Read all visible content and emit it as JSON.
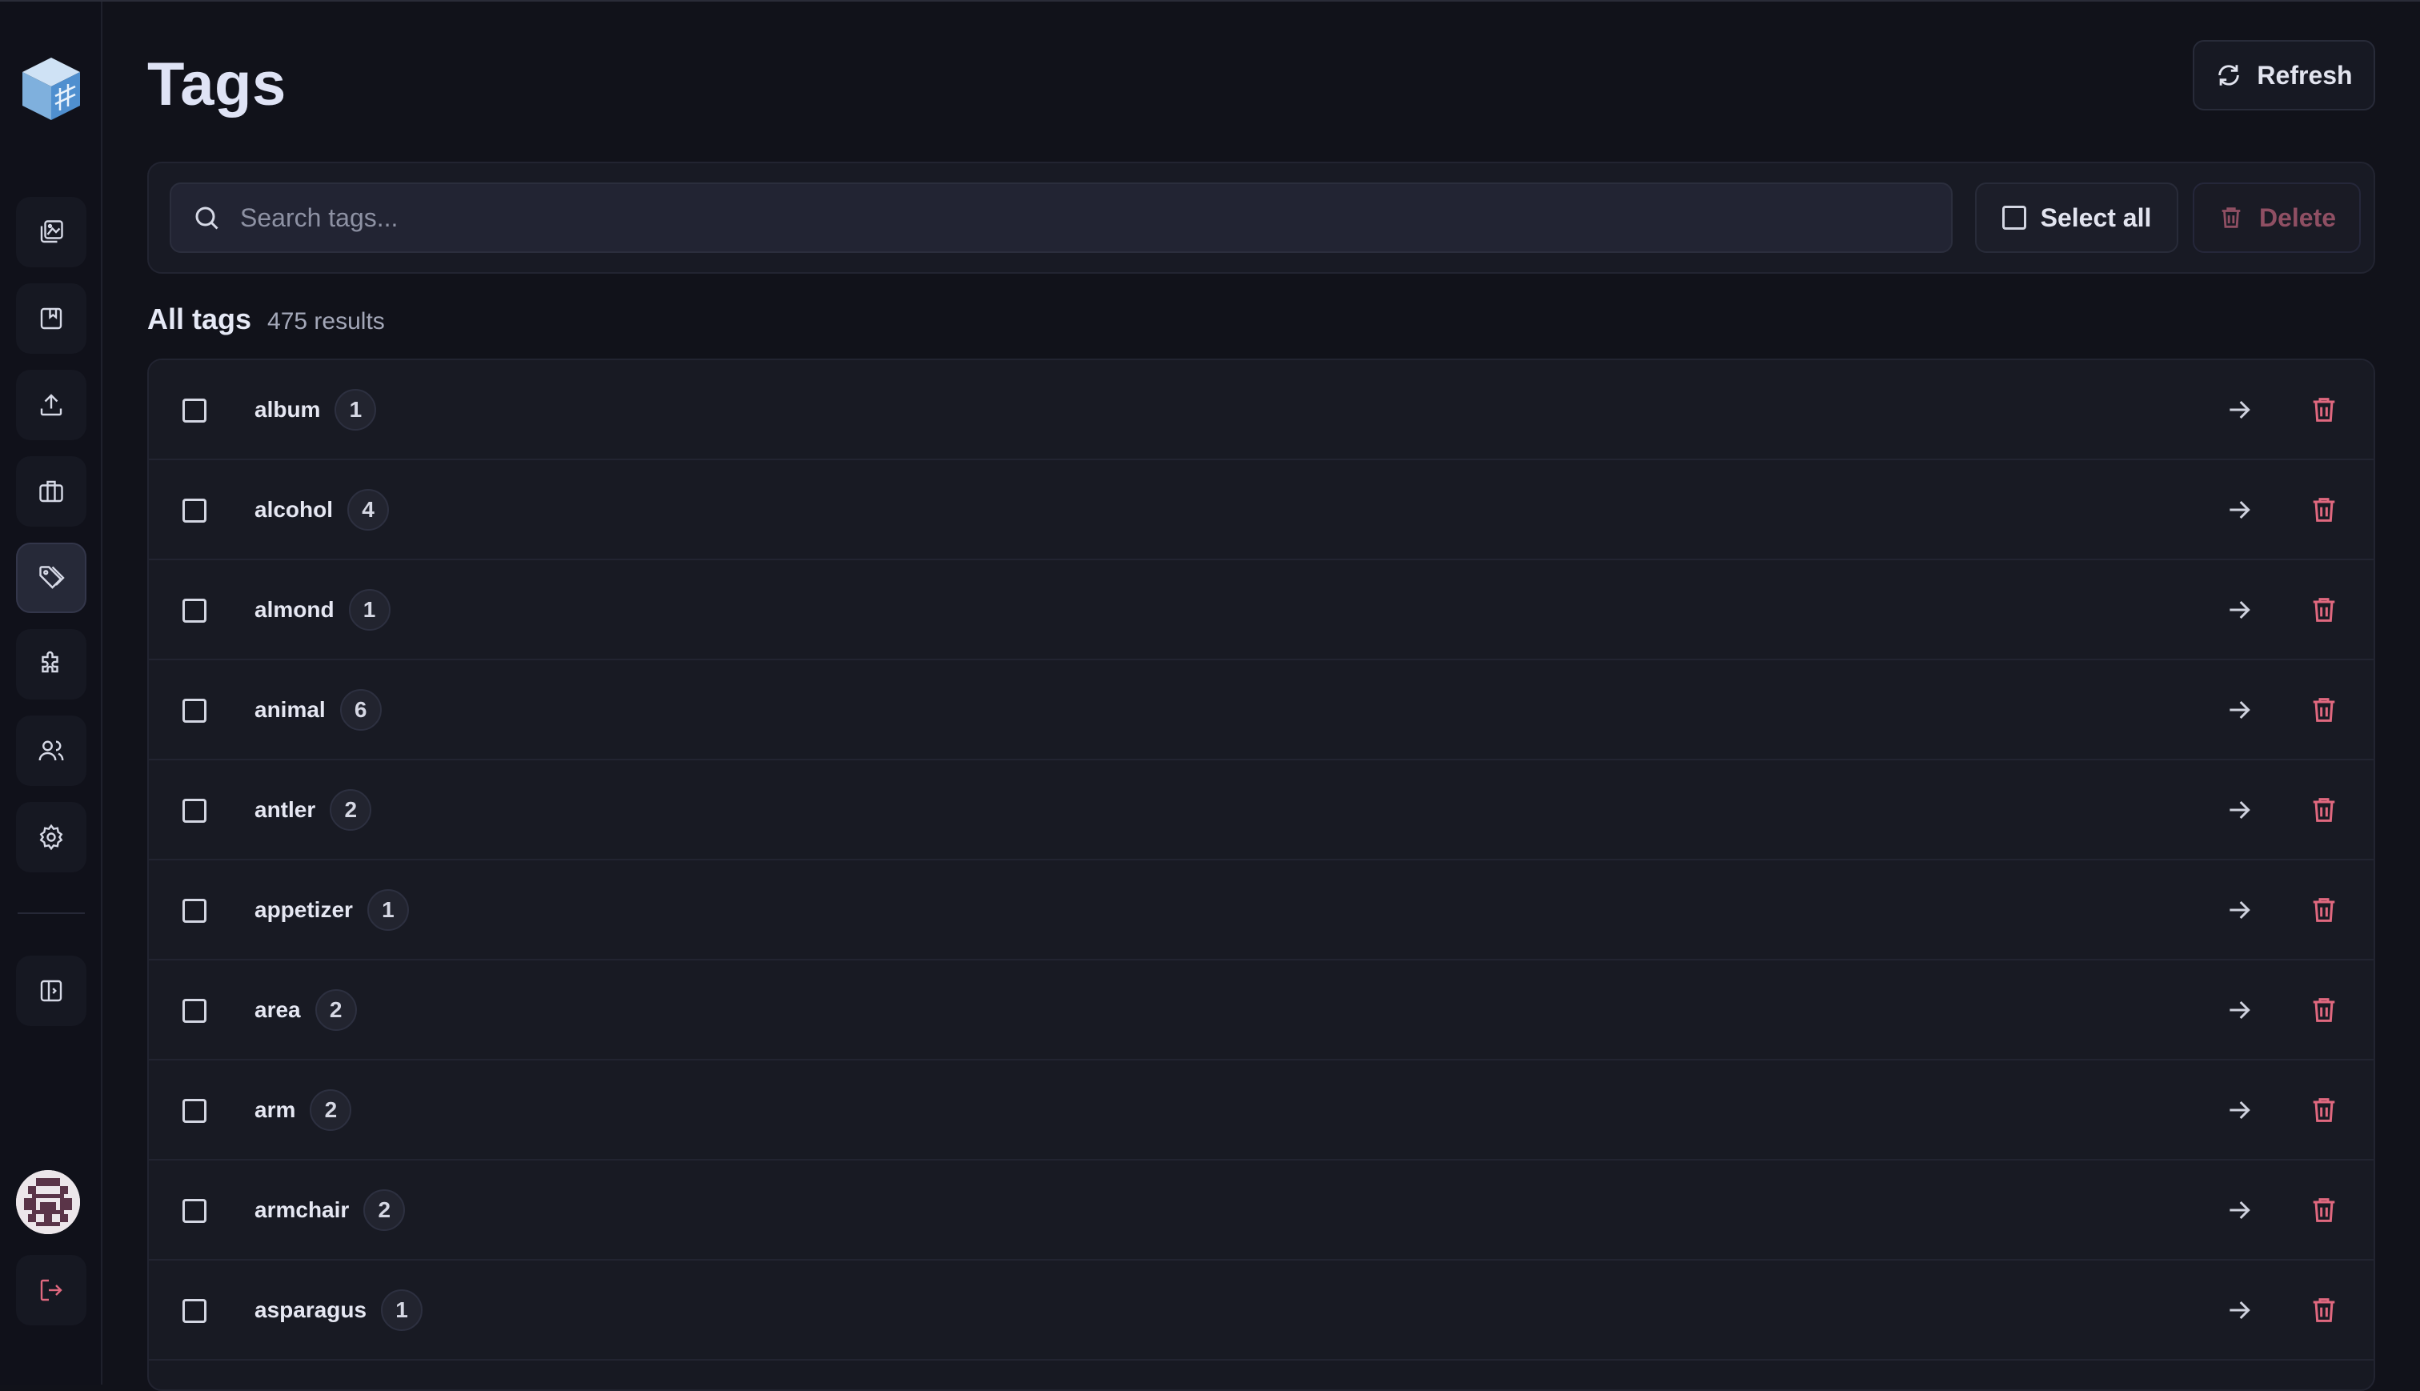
{
  "page": {
    "title": "Tags",
    "refresh_label": "Refresh"
  },
  "toolbar": {
    "search_placeholder": "Search tags...",
    "search_value": "",
    "select_all_label": "Select all",
    "delete_label": "Delete"
  },
  "results": {
    "heading": "All tags",
    "count_label": "475 results"
  },
  "tags": [
    {
      "name": "album",
      "count": "1"
    },
    {
      "name": "alcohol",
      "count": "4"
    },
    {
      "name": "almond",
      "count": "1"
    },
    {
      "name": "animal",
      "count": "6"
    },
    {
      "name": "antler",
      "count": "2"
    },
    {
      "name": "appetizer",
      "count": "1"
    },
    {
      "name": "area",
      "count": "2"
    },
    {
      "name": "arm",
      "count": "2"
    },
    {
      "name": "armchair",
      "count": "2"
    },
    {
      "name": "asparagus",
      "count": "1"
    }
  ],
  "sidebar": {
    "items": [
      {
        "icon": "photos-icon",
        "active": false
      },
      {
        "icon": "albums-icon",
        "active": false
      },
      {
        "icon": "upload-icon",
        "active": false
      },
      {
        "icon": "collections-icon",
        "active": false
      },
      {
        "icon": "tag-icon",
        "active": true
      },
      {
        "icon": "puzzle-icon",
        "active": false
      },
      {
        "icon": "users-icon",
        "active": false
      },
      {
        "icon": "settings-icon",
        "active": false
      }
    ],
    "toggle_icon": "sidebar-toggle-icon",
    "logout_icon": "logout-icon"
  },
  "colors": {
    "background": "#11121a",
    "danger": "#e0687f",
    "text": "#e6e7ee"
  }
}
